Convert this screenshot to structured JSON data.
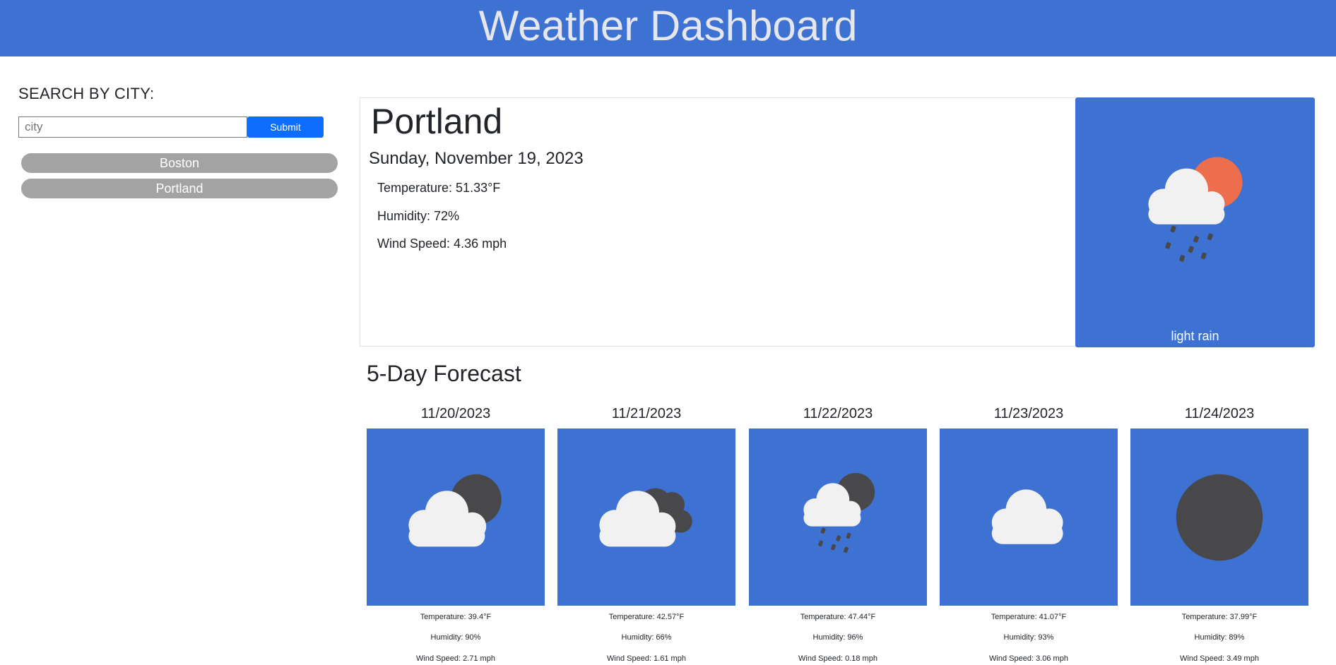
{
  "header": {
    "title": "Weather Dashboard"
  },
  "search": {
    "heading": "SEARCH BY CITY:",
    "placeholder": "city",
    "value": "",
    "submit_label": "Submit",
    "history": [
      "Boston",
      "Portland"
    ]
  },
  "current": {
    "city": "Portland",
    "date": "Sunday, November 19, 2023",
    "temperature": "Temperature: 51.33°F",
    "humidity": "Humidity: 72%",
    "wind": "Wind Speed: 4.36 mph",
    "icon": "light-rain-icon",
    "description": "light rain"
  },
  "forecast": {
    "title": "5-Day Forecast",
    "days": [
      {
        "date": "11/20/2023",
        "icon": "cloud-with-moon-icon",
        "temperature": "Temperature: 39.4°F",
        "humidity": "Humidity: 90%",
        "wind": "Wind Speed: 2.71 mph"
      },
      {
        "date": "11/21/2023",
        "icon": "broken-clouds-icon",
        "temperature": "Temperature: 42.57°F",
        "humidity": "Humidity: 66%",
        "wind": "Wind Speed: 1.61 mph"
      },
      {
        "date": "11/22/2023",
        "icon": "rain-night-icon",
        "temperature": "Temperature: 47.44°F",
        "humidity": "Humidity: 96%",
        "wind": "Wind Speed: 0.18 mph"
      },
      {
        "date": "11/23/2023",
        "icon": "cloud-icon",
        "temperature": "Temperature: 41.07°F",
        "humidity": "Humidity: 93%",
        "wind": "Wind Speed: 3.06 mph"
      },
      {
        "date": "11/24/2023",
        "icon": "clear-night-icon",
        "temperature": "Temperature: 37.99°F",
        "humidity": "Humidity: 89%",
        "wind": "Wind Speed: 3.49 mph"
      }
    ]
  },
  "colors": {
    "header_bg": "#3d72d2",
    "card_bg": "#3d72d2",
    "submit_bg": "#0d6efd",
    "history_bg": "#a3a3a3",
    "sun": "#ec6e4c",
    "moon": "#48484a",
    "cloud": "#f1f1f1"
  }
}
